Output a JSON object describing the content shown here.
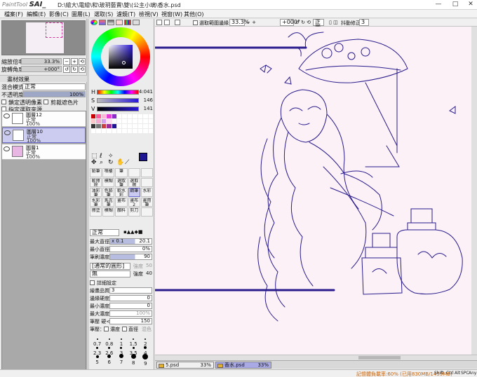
{
  "window": {
    "app_name": "PaintTool SAI",
    "app_prefix": "PaintTool",
    "app_short": "SAI_",
    "doc_path": "D:\\繪大\\電繪\\和\\玻玥藝賣\\雙\\(公主小璃\\香水.psd",
    "minimize": "—",
    "maximize": "□",
    "close": "✕"
  },
  "menu": [
    "檔案(F)",
    "編輯(E)",
    "影像(C)",
    "圖層(L)",
    "選取(S)",
    "濾鏡(T)",
    "檢視(V)",
    "視窗(W)",
    "其他(O)"
  ],
  "navigator": {
    "zoom_label": "縮放倍率",
    "zoom_value": "33.3%",
    "rotate_label": "旋轉角度",
    "rotate_value": "+000°"
  },
  "layer_panel": {
    "section": "畫材效果",
    "blend_label": "混合模式",
    "blend_value": "正常",
    "opacity_label": "不透明度",
    "opacity_value": "100%",
    "lock_alpha": "鎖定透明像素",
    "clip": "剪裁遮色片",
    "select_source": "指定選取來源",
    "layers": [
      {
        "name": "圖層12",
        "mode": "正常",
        "opacity": "100%"
      },
      {
        "name": "圖層10",
        "mode": "正常",
        "opacity": "100%"
      },
      {
        "name": "圖層1",
        "mode": "正常",
        "opacity": "100%"
      }
    ]
  },
  "color": {
    "h_label": "H",
    "h_value": "4:041",
    "s_label": "S",
    "s_value": "146",
    "v_label": "V",
    "v_value": "141",
    "fg_color": "#1d1591"
  },
  "tools": [
    "鉛筆",
    "噴槍",
    "筆",
    "",
    "",
    "軟擦除",
    "模糊",
    "選取筆",
    "選取擦",
    "",
    "油彩筆",
    "色鉛筆",
    "軟水彩",
    "鋼筆",
    "水彩",
    "水彩筆",
    "馬克筆",
    "畫布",
    "畫布2",
    "畫用筆",
    "擦塗",
    "模糊",
    "顏料",
    "剪刀",
    ""
  ],
  "brush": {
    "mode_value": "正常",
    "size_label": "最大直徑",
    "size_mult": "x 0.1",
    "size_value": "20.1",
    "min_label": "最小直徑",
    "min_value": "0%",
    "density_label": "筆刷濃度",
    "density_value": "90",
    "shape_value": "[通常的圓形]",
    "shape_strength": "強度",
    "shape_strength_value": "50",
    "texture_value": "無",
    "texture_strength": "強度",
    "texture_strength_value": "40",
    "detail_header": "詳細設定",
    "quality_label": "繪畫品質",
    "quality_value": "3",
    "edge_label": "邊緣硬度",
    "edge_value": "0",
    "min_density_label": "最小濃度",
    "min_density_value": "0",
    "max_pressure_label": "最大濃度筆壓",
    "max_pressure_value": "100%",
    "pressure_label": "筆壓 硬<->軟",
    "pressure_value": "150",
    "pen_pressure_label": "筆壓：",
    "density_check": "濃度",
    "size_check": "直徑",
    "blend_check": "混色"
  },
  "brush_sizes": [
    "0.7",
    "0.8",
    "1",
    "1.5",
    "2",
    "2.3",
    "2.6",
    "3",
    "3.5",
    "4",
    "5",
    "6",
    "7",
    "8",
    "9"
  ],
  "canvas_toolbar": {
    "antialias": "選取範圍邊緣",
    "zoom": "33.3%",
    "angle": "+000°",
    "mode": "正常",
    "stabilizer_label": "抖動修正",
    "stabilizer_value": "3"
  },
  "doc_tabs": [
    {
      "name": "5.psd",
      "zoom": "33%"
    },
    {
      "name": "香水.psd",
      "zoom": "33%"
    }
  ],
  "status": {
    "memory": "記憶體負載率:60% (已用830MB/1459MB)",
    "keys": [
      "Shift",
      "Ctrl",
      "Alt",
      "SPC",
      "Any"
    ]
  }
}
